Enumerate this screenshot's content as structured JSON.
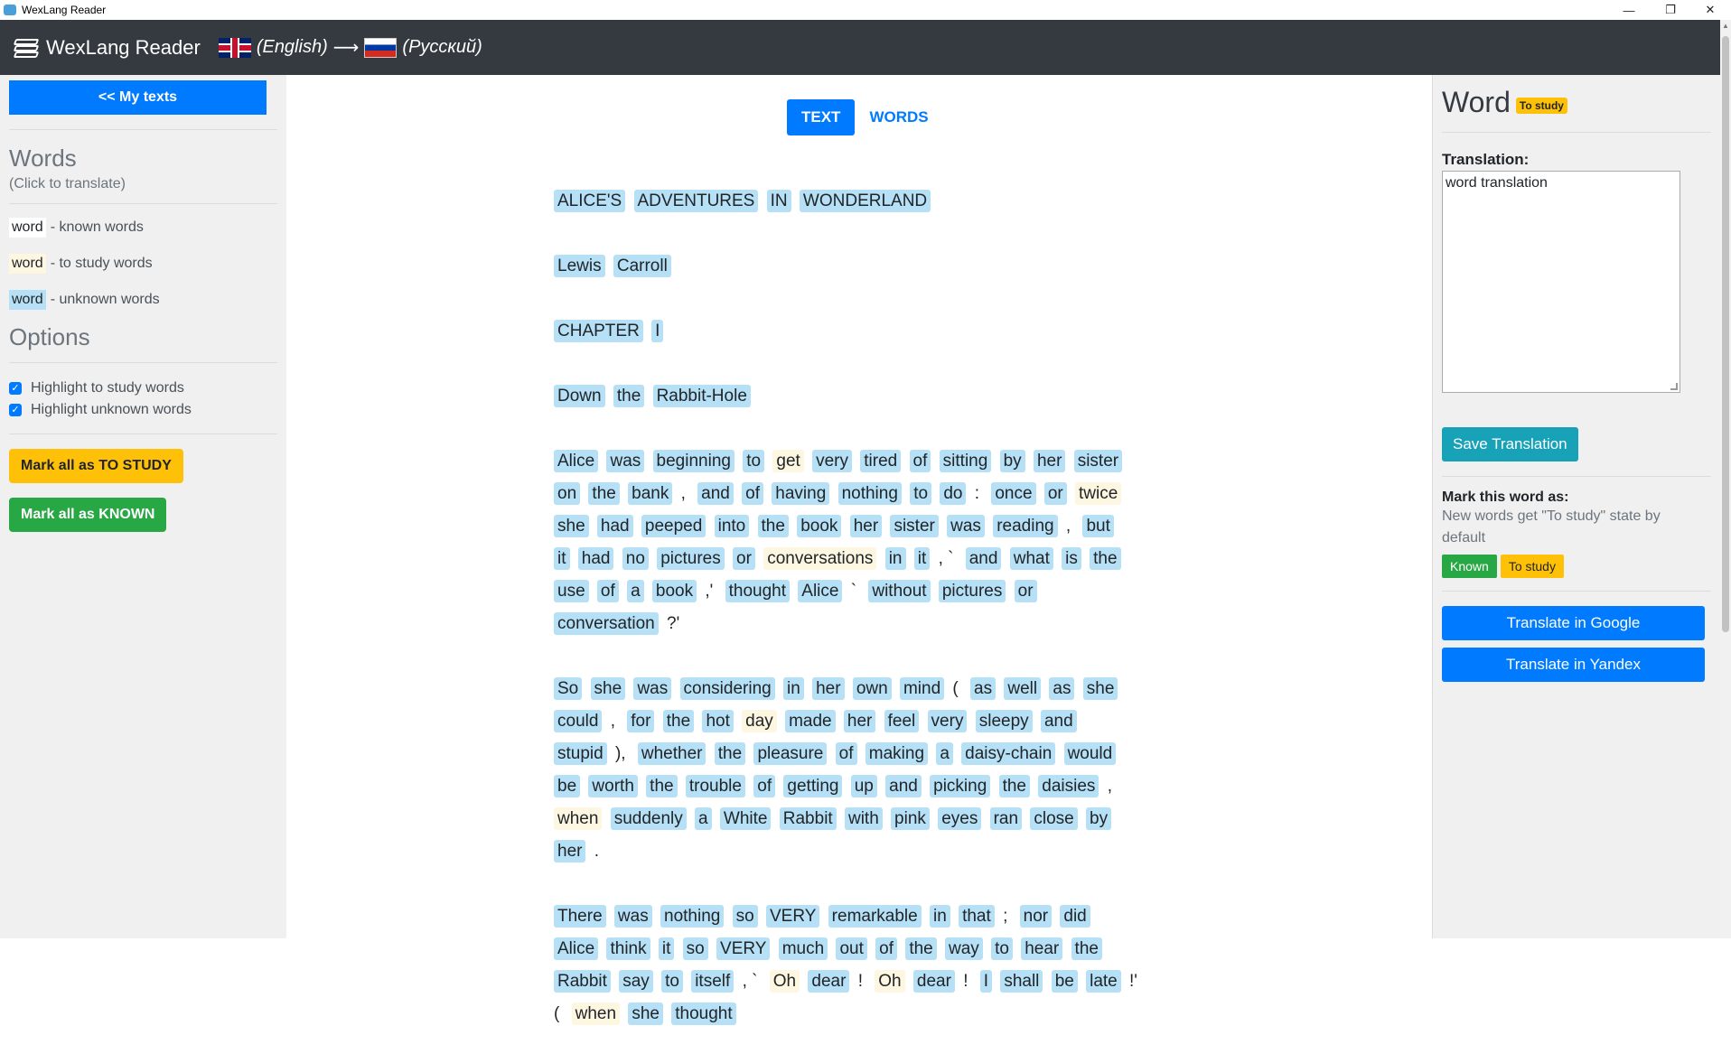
{
  "window": {
    "title": "WexLang Reader",
    "minimize": "—",
    "restore": "❐",
    "close": "✕"
  },
  "navbar": {
    "brand": "WexLang Reader",
    "from_lang": "(English)",
    "arrow": "⟶",
    "to_lang": "(Русский)"
  },
  "left": {
    "my_texts": "<< My texts",
    "words_heading": "Words",
    "words_hint": "(Click to translate)",
    "legend": [
      {
        "word": "word",
        "desc": "- known words",
        "state": "known"
      },
      {
        "word": "word",
        "desc": "- to study words",
        "state": "study"
      },
      {
        "word": "word",
        "desc": "- unknown words",
        "state": "unknown"
      }
    ],
    "options_heading": "Options",
    "opt_study": "Highlight to study words",
    "opt_unknown": "Highlight unknown words",
    "mark_study": "Mark all as TO STUDY",
    "mark_known": "Mark all as KNOWN"
  },
  "tabs": {
    "text": "TEXT",
    "words": "WORDS"
  },
  "text_paragraphs": [
    [
      [
        "ALICE'S",
        "u"
      ],
      [
        "ADVENTURES",
        "u"
      ],
      [
        "IN",
        "u"
      ],
      [
        "WONDERLAND",
        "u"
      ]
    ],
    [
      [
        "Lewis",
        "u"
      ],
      [
        "Carroll",
        "u"
      ]
    ],
    [
      [
        "CHAPTER",
        "u"
      ],
      [
        "I",
        "u"
      ]
    ],
    [
      [
        "Down",
        "u"
      ],
      [
        "the",
        "u"
      ],
      [
        "Rabbit-Hole",
        "u"
      ]
    ],
    [
      [
        "Alice",
        "u"
      ],
      [
        "was",
        "u"
      ],
      [
        "beginning",
        "u"
      ],
      [
        "to",
        "u"
      ],
      [
        "get",
        "s"
      ],
      [
        "very",
        "u"
      ],
      [
        "tired",
        "u"
      ],
      [
        "of",
        "u"
      ],
      [
        "sitting",
        "u"
      ],
      [
        "by",
        "u"
      ],
      [
        "her",
        "u"
      ],
      [
        "sister",
        "u"
      ],
      [
        "on",
        "u"
      ],
      [
        "the",
        "u"
      ],
      [
        "bank",
        "u"
      ],
      [
        ",",
        "p"
      ],
      [
        "and",
        "u"
      ],
      [
        "of",
        "u"
      ],
      [
        "having",
        "u"
      ],
      [
        "nothing",
        "u"
      ],
      [
        "to",
        "u"
      ],
      [
        "do",
        "u"
      ],
      [
        ":",
        "p"
      ],
      [
        "once",
        "u"
      ],
      [
        "or",
        "u"
      ],
      [
        "twice",
        "s"
      ],
      [
        "she",
        "u"
      ],
      [
        "had",
        "u"
      ],
      [
        "peeped",
        "u"
      ],
      [
        "into",
        "u"
      ],
      [
        "the",
        "u"
      ],
      [
        "book",
        "u"
      ],
      [
        "her",
        "u"
      ],
      [
        "sister",
        "u"
      ],
      [
        "was",
        "u"
      ],
      [
        "reading",
        "u"
      ],
      [
        ",",
        "p"
      ],
      [
        "but",
        "u"
      ],
      [
        "it",
        "u"
      ],
      [
        "had",
        "u"
      ],
      [
        "no",
        "u"
      ],
      [
        "pictures",
        "u"
      ],
      [
        "or",
        "u"
      ],
      [
        "conversations",
        "s"
      ],
      [
        "in",
        "u"
      ],
      [
        "it",
        "u"
      ],
      [
        ", `",
        "p"
      ],
      [
        "and",
        "u"
      ],
      [
        "what",
        "u"
      ],
      [
        "is",
        "u"
      ],
      [
        "the",
        "u"
      ],
      [
        "use",
        "u"
      ],
      [
        "of",
        "u"
      ],
      [
        "a",
        "u"
      ],
      [
        "book",
        "u"
      ],
      [
        ",'",
        "p"
      ],
      [
        "thought",
        "u"
      ],
      [
        "Alice",
        "u"
      ],
      [
        "`",
        "p"
      ],
      [
        "without",
        "u"
      ],
      [
        "pictures",
        "u"
      ],
      [
        "or",
        "u"
      ],
      [
        "conversation",
        "u"
      ],
      [
        "?'",
        "p"
      ]
    ],
    [
      [
        "So",
        "u"
      ],
      [
        "she",
        "u"
      ],
      [
        "was",
        "u"
      ],
      [
        "considering",
        "u"
      ],
      [
        "in",
        "u"
      ],
      [
        "her",
        "u"
      ],
      [
        "own",
        "u"
      ],
      [
        "mind",
        "u"
      ],
      [
        "(",
        "p"
      ],
      [
        "as",
        "u"
      ],
      [
        "well",
        "u"
      ],
      [
        "as",
        "u"
      ],
      [
        "she",
        "u"
      ],
      [
        "could",
        "u"
      ],
      [
        ",",
        "p"
      ],
      [
        "for",
        "u"
      ],
      [
        "the",
        "u"
      ],
      [
        "hot",
        "u"
      ],
      [
        "day",
        "s"
      ],
      [
        "made",
        "u"
      ],
      [
        "her",
        "u"
      ],
      [
        "feel",
        "u"
      ],
      [
        "very",
        "u"
      ],
      [
        "sleepy",
        "u"
      ],
      [
        "and",
        "u"
      ],
      [
        "stupid",
        "u"
      ],
      [
        "),",
        "p"
      ],
      [
        "whether",
        "u"
      ],
      [
        "the",
        "u"
      ],
      [
        "pleasure",
        "u"
      ],
      [
        "of",
        "u"
      ],
      [
        "making",
        "u"
      ],
      [
        "a",
        "u"
      ],
      [
        "daisy-chain",
        "u"
      ],
      [
        "would",
        "u"
      ],
      [
        "be",
        "u"
      ],
      [
        "worth",
        "u"
      ],
      [
        "the",
        "u"
      ],
      [
        "trouble",
        "u"
      ],
      [
        "of",
        "u"
      ],
      [
        "getting",
        "u"
      ],
      [
        "up",
        "u"
      ],
      [
        "and",
        "u"
      ],
      [
        "picking",
        "u"
      ],
      [
        "the",
        "u"
      ],
      [
        "daisies",
        "u"
      ],
      [
        ",",
        "p"
      ],
      [
        "when",
        "s"
      ],
      [
        "suddenly",
        "u"
      ],
      [
        "a",
        "u"
      ],
      [
        "White",
        "u"
      ],
      [
        "Rabbit",
        "u"
      ],
      [
        "with",
        "u"
      ],
      [
        "pink",
        "u"
      ],
      [
        "eyes",
        "u"
      ],
      [
        "ran",
        "u"
      ],
      [
        "close",
        "u"
      ],
      [
        "by",
        "u"
      ],
      [
        "her",
        "u"
      ],
      [
        ".",
        "p"
      ]
    ],
    [
      [
        "There",
        "u"
      ],
      [
        "was",
        "u"
      ],
      [
        "nothing",
        "u"
      ],
      [
        "so",
        "u"
      ],
      [
        "VERY",
        "u"
      ],
      [
        "remarkable",
        "u"
      ],
      [
        "in",
        "u"
      ],
      [
        "that",
        "u"
      ],
      [
        ";",
        "p"
      ],
      [
        "nor",
        "u"
      ],
      [
        "did",
        "u"
      ],
      [
        "Alice",
        "u"
      ],
      [
        "think",
        "u"
      ],
      [
        "it",
        "u"
      ],
      [
        "so",
        "u"
      ],
      [
        "VERY",
        "u"
      ],
      [
        "much",
        "u"
      ],
      [
        "out",
        "u"
      ],
      [
        "of",
        "u"
      ],
      [
        "the",
        "u"
      ],
      [
        "way",
        "u"
      ],
      [
        "to",
        "u"
      ],
      [
        "hear",
        "u"
      ],
      [
        "the",
        "u"
      ],
      [
        "Rabbit",
        "u"
      ],
      [
        "say",
        "u"
      ],
      [
        "to",
        "u"
      ],
      [
        "itself",
        "u"
      ],
      [
        ", `",
        "p"
      ],
      [
        "Oh",
        "s"
      ],
      [
        "dear",
        "u"
      ],
      [
        "!",
        "p"
      ],
      [
        "Oh",
        "s"
      ],
      [
        "dear",
        "u"
      ],
      [
        "!",
        "p"
      ],
      [
        "I",
        "u"
      ],
      [
        "shall",
        "u"
      ],
      [
        "be",
        "u"
      ],
      [
        "late",
        "u"
      ],
      [
        "!' (",
        "p"
      ],
      [
        "when",
        "s"
      ],
      [
        "she",
        "u"
      ],
      [
        "thought",
        "u"
      ]
    ]
  ],
  "right": {
    "word": "Word",
    "state_badge": "To study",
    "translation_label": "Translation:",
    "translation_value": "word translation",
    "save_btn": "Save Translation",
    "mark_label": "Mark this word as:",
    "mark_hint": "New words get \"To study\" state by default",
    "known_btn": "Known",
    "study_btn": "To study",
    "google_btn": "Translate in Google",
    "yandex_btn": "Translate in Yandex"
  },
  "colors": {
    "navbar": "#343a40",
    "primary": "#007bff",
    "warning": "#ffc107",
    "success": "#28a745",
    "info": "#17a2b8",
    "unknown_highlight": "#b6e0f5",
    "study_highlight": "#fdf6e0"
  }
}
